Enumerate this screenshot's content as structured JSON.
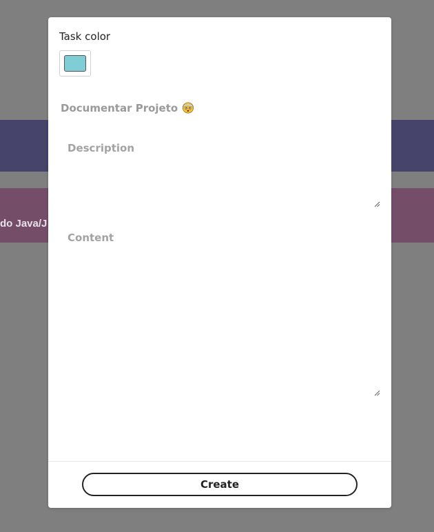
{
  "background": {
    "card_text": "do Java/J",
    "colors": {
      "overlay": "#7f7f7f",
      "purple_card": "#47446b",
      "pink_card": "#744d68"
    }
  },
  "modal": {
    "task_color_label": "Task color",
    "task_color_value": "#80cdd6",
    "title_value": "Documentar Projeto",
    "title_emoji_icon": "face-with-head-bandage-icon",
    "description_placeholder": "Description",
    "content_placeholder": "Content",
    "create_label": "Create"
  }
}
